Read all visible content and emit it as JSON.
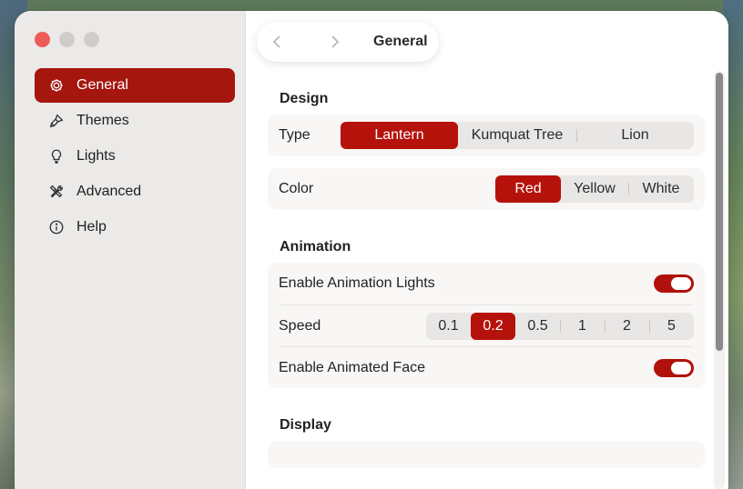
{
  "window": {
    "title": "General"
  },
  "sidebar": {
    "items": [
      {
        "label": "General",
        "icon": "gear-icon",
        "active": true
      },
      {
        "label": "Themes",
        "icon": "paintbrush-icon",
        "active": false
      },
      {
        "label": "Lights",
        "icon": "lightbulb-icon",
        "active": false
      },
      {
        "label": "Advanced",
        "icon": "tools-icon",
        "active": false
      },
      {
        "label": "Help",
        "icon": "info-icon",
        "active": false
      }
    ]
  },
  "colors": {
    "accent": "#b5120b",
    "sidebar_active": "#a4160e"
  },
  "design": {
    "title": "Design",
    "type": {
      "label": "Type",
      "options": [
        "Lantern",
        "Kumquat Tree",
        "Lion"
      ],
      "selected": "Lantern"
    },
    "color": {
      "label": "Color",
      "options": [
        "Red",
        "Yellow",
        "White"
      ],
      "selected": "Red"
    }
  },
  "animation": {
    "title": "Animation",
    "enable_lights": {
      "label": "Enable Animation Lights",
      "on": true
    },
    "speed": {
      "label": "Speed",
      "options": [
        "0.1",
        "0.2",
        "0.5",
        "1",
        "2",
        "5"
      ],
      "selected": "0.2"
    },
    "enable_face": {
      "label": "Enable Animated Face",
      "on": true
    }
  },
  "display": {
    "title": "Display"
  }
}
